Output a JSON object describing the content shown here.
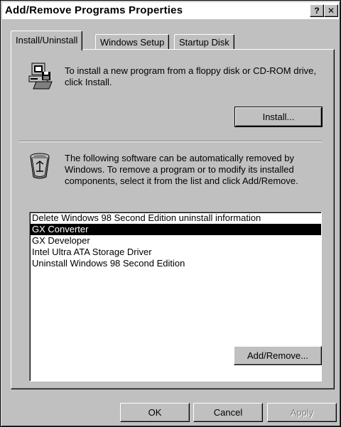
{
  "window": {
    "title": "Add/Remove Programs Properties",
    "help_label": "?",
    "close_label": "✕"
  },
  "tabs": [
    {
      "label": "Install/Uninstall",
      "active": true
    },
    {
      "label": "Windows Setup",
      "active": false
    },
    {
      "label": "Startup Disk",
      "active": false
    }
  ],
  "install_section": {
    "text": "To install a new program from a floppy disk or CD-ROM drive, click Install.",
    "button_label": "Install...",
    "icon": "computer-floppy-icon"
  },
  "remove_section": {
    "text": "The following software can be automatically removed by Windows. To remove a program or to modify its installed components, select it from the list and click Add/Remove.",
    "icon": "recycle-bin-icon",
    "programs": [
      "Delete Windows 98 Second Edition uninstall information",
      "GX Converter",
      "GX Developer",
      "Intel Ultra ATA Storage Driver",
      "Uninstall Windows 98 Second Edition"
    ],
    "selected_index": 1,
    "button_label": "Add/Remove..."
  },
  "footer": {
    "ok_label": "OK",
    "cancel_label": "Cancel",
    "apply_label": "Apply"
  }
}
